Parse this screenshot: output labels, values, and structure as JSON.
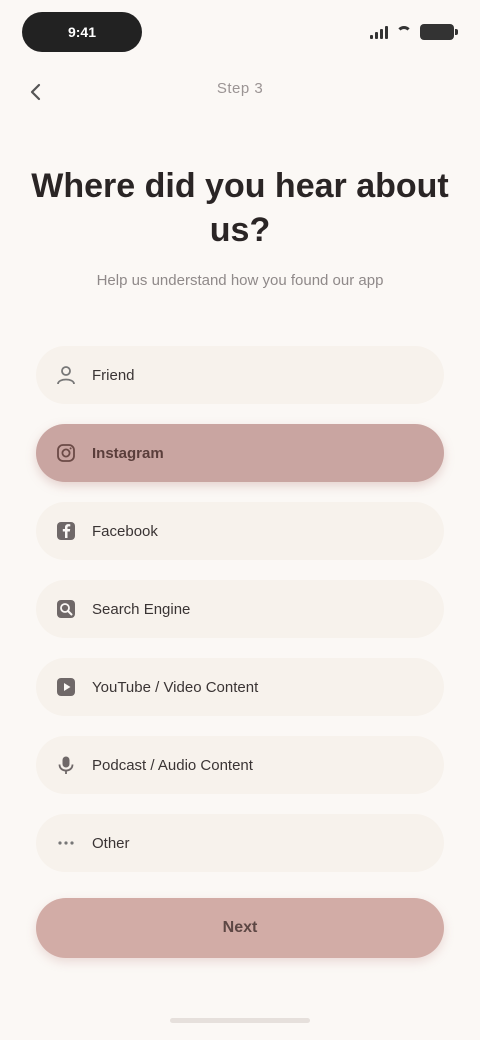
{
  "status_bar": {
    "time": "9:41"
  },
  "nav": {
    "title": "Step 3"
  },
  "heading": "Where did you hear about us?",
  "subheading": "Help us understand how you found our app",
  "options": [
    {
      "label": "Friend",
      "icon": "user-icon",
      "selected": false
    },
    {
      "label": "Instagram",
      "icon": "instagram-icon",
      "selected": true
    },
    {
      "label": "Facebook",
      "icon": "facebook-icon",
      "selected": false
    },
    {
      "label": "Search Engine",
      "icon": "search-icon",
      "selected": false
    },
    {
      "label": "YouTube / Video Content",
      "icon": "video-icon",
      "selected": false
    },
    {
      "label": "Podcast / Audio Content",
      "icon": "podcast-icon",
      "selected": false
    },
    {
      "label": "Other",
      "icon": "ellipsis-icon",
      "selected": false
    }
  ],
  "next_button": "Next",
  "colors": {
    "background": "#fbf8f5",
    "accent": "#c9a5a1",
    "option_bg": "#f7f2ec"
  }
}
